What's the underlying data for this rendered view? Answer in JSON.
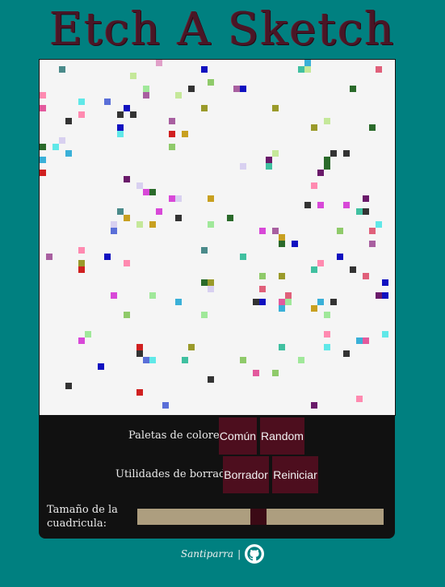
{
  "app": {
    "title": "Etch A Sketch"
  },
  "controls": {
    "palettes_label": "Paletas de colores:",
    "common_button": "Común",
    "random_button": "Random",
    "erase_label": "Utilidades de borrado:",
    "eraser_button": "Borrador",
    "reset_button": "Reiniciar",
    "grid_size_label": "Tamaño de la cuadricula:"
  },
  "footer": {
    "author": "Santiparra",
    "separator": "|",
    "icon": "github-icon"
  },
  "colors": {
    "background": "#008080",
    "title": "#4a1626",
    "board": "#f5f5f5",
    "panel": "#111111",
    "button": "#4d0e1e",
    "slider_track": "#ad9e7f",
    "slider_thumb": "#3b0a15"
  }
}
